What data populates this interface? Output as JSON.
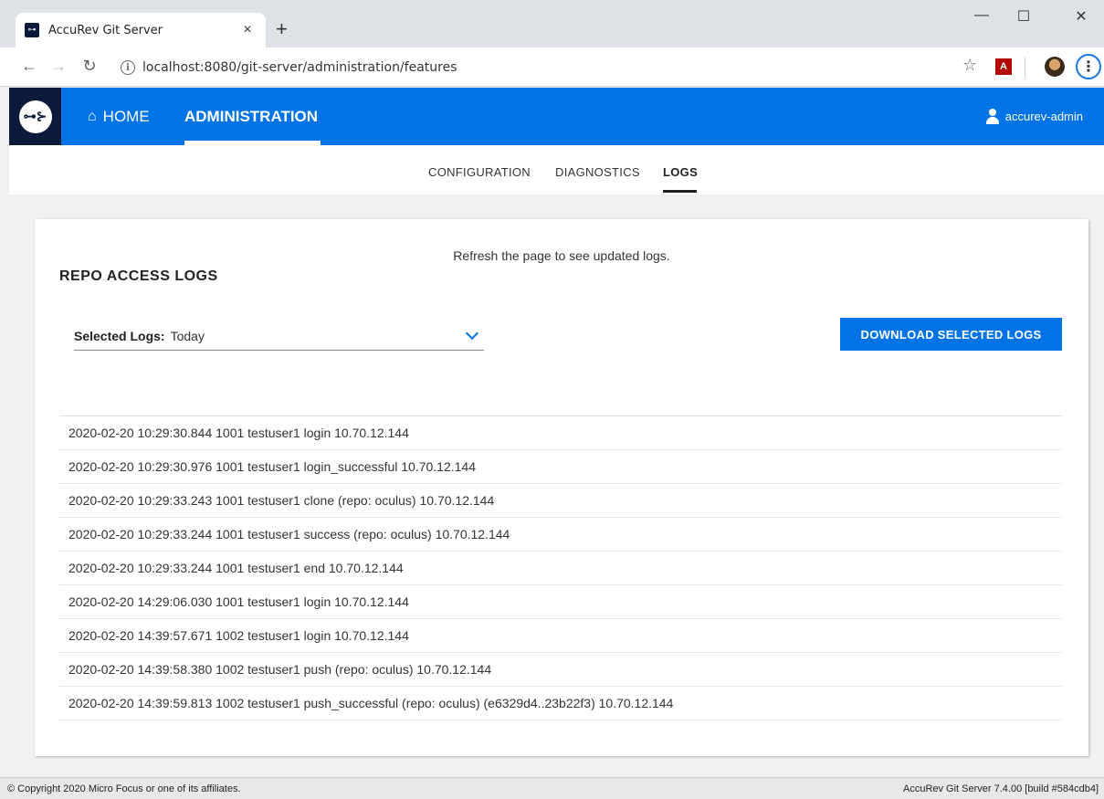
{
  "browser": {
    "tab_title": "AccuRev Git Server",
    "tab_close": "×",
    "new_tab": "+",
    "url": "localhost:8080/git-server/administration/features",
    "favicon_text": "⊶",
    "window_min": "—",
    "window_max": "☐",
    "window_close": "✕"
  },
  "appbar": {
    "logo_text": "⊶⊱",
    "home_label": "HOME",
    "admin_label": "ADMINISTRATION",
    "user_name": "accurev-admin"
  },
  "subnav": {
    "tabs": [
      {
        "label": "CONFIGURATION"
      },
      {
        "label": "DIAGNOSTICS"
      },
      {
        "label": "LOGS"
      }
    ]
  },
  "main": {
    "refresh_note": "Refresh the page to see updated logs.",
    "section_title": "REPO ACCESS LOGS",
    "selected_logs_label": "Selected Logs:",
    "selected_logs_value": "Today",
    "download_button": "DOWNLOAD SELECTED LOGS",
    "logs": [
      "2020-02-20 10:29:30.844 1001 testuser1 login 10.70.12.144",
      "2020-02-20 10:29:30.976 1001 testuser1 login_successful 10.70.12.144",
      "2020-02-20 10:29:33.243 1001 testuser1 clone (repo: oculus) 10.70.12.144",
      "2020-02-20 10:29:33.244 1001 testuser1 success (repo: oculus) 10.70.12.144",
      "2020-02-20 10:29:33.244 1001 testuser1 end 10.70.12.144",
      "2020-02-20 14:29:06.030 1001 testuser1 login 10.70.12.144",
      "2020-02-20 14:39:57.671 1002 testuser1 login 10.70.12.144",
      "2020-02-20 14:39:58.380 1002 testuser1 push (repo: oculus) 10.70.12.144",
      "2020-02-20 14:39:59.813 1002 testuser1 push_successful (repo: oculus) (e6329d4..23b22f3) 10.70.12.144"
    ]
  },
  "footer": {
    "copyright": "© Copyright 2020 Micro Focus or one of its affiliates.",
    "version": "AccuRev Git Server 7.4.00 [build #584cdb4]"
  },
  "colors": {
    "accent": "#0073e7",
    "logo_bg": "#0b1a3b"
  }
}
